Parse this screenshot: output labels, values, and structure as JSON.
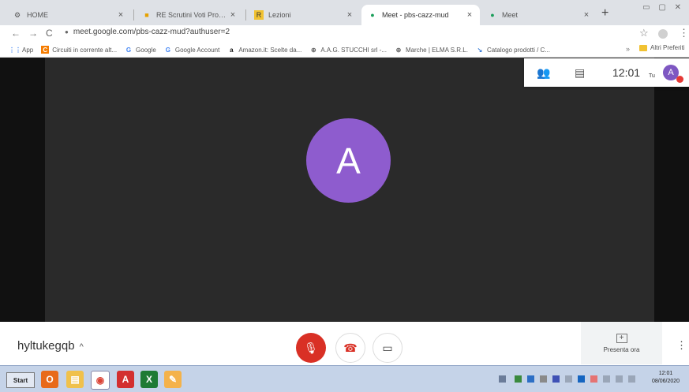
{
  "browser": {
    "tabs": [
      {
        "label": "HOME",
        "icon": "home-icon",
        "active": false
      },
      {
        "label": "RE Scrutini Voti Proposti",
        "icon": "re-icon",
        "active": false
      },
      {
        "label": "Lezioni",
        "icon": "lezioni-icon",
        "active": false
      },
      {
        "label": "Meet - pbs-cazz-mud",
        "icon": "meet-icon",
        "active": true
      },
      {
        "label": "Meet",
        "icon": "meet-icon",
        "active": false
      }
    ],
    "url": "meet.google.com/pbs-cazz-mud?authuser=2",
    "bookmarks": [
      {
        "label": "App",
        "icon": "apps-grid-icon"
      },
      {
        "label": "Circuiti in corrente alt...",
        "icon": "bookmark-icon"
      },
      {
        "label": "Google",
        "icon": "google-icon"
      },
      {
        "label": "Google Account",
        "icon": "google-icon"
      },
      {
        "label": "Amazon.it: Scelte da...",
        "icon": "amazon-icon"
      },
      {
        "label": "A.A.G. STUCCHI srl -...",
        "icon": "globe-icon"
      },
      {
        "label": "Marche | ELMA S.R.L.",
        "icon": "globe-icon"
      },
      {
        "label": "Catalogo prodotti / C...",
        "icon": "catalog-icon"
      }
    ],
    "bookmarks_more": "»",
    "other_bookmarks": "Altri Preferiti"
  },
  "meet": {
    "time": "12:01",
    "you_label": "Tu",
    "avatar_letter": "A",
    "main_avatar_letter": "A",
    "meeting_code": "hyltukegqb",
    "present_label": "Presenta ora",
    "colors": {
      "avatar": "#8e5cce",
      "mic_off": "#d93025",
      "hangup": "#d93025"
    }
  },
  "taskbar": {
    "start_label": "Start",
    "clock_time": "12:01",
    "clock_date": "08/06/2020"
  }
}
